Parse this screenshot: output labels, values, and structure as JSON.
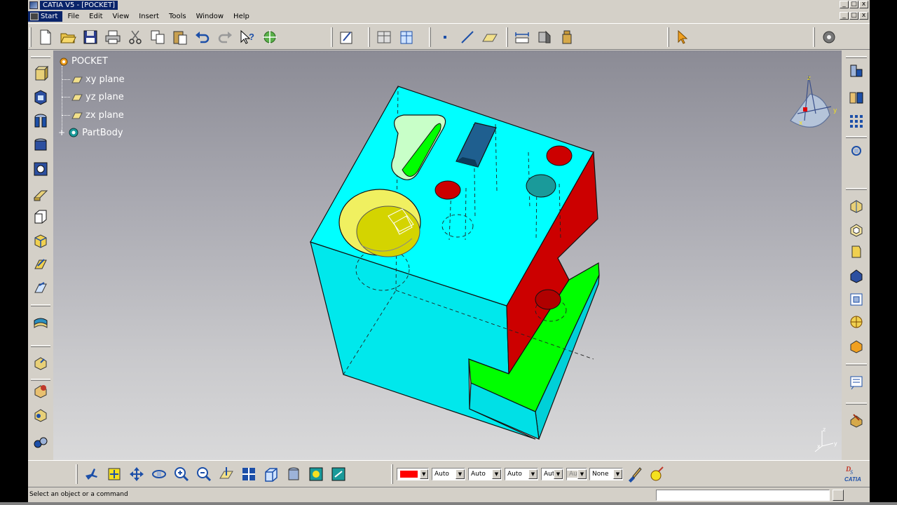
{
  "window": {
    "title": "CATIA V5 - [POCKET]",
    "controls": [
      "_",
      "□",
      "x"
    ]
  },
  "menu": {
    "items": [
      "Start",
      "File",
      "Edit",
      "View",
      "Insert",
      "Tools",
      "Window",
      "Help"
    ]
  },
  "tree": {
    "root": "POCKET",
    "children": [
      "xy plane",
      "yz plane",
      "zx plane",
      "PartBody"
    ]
  },
  "properties": {
    "fill_color": "#ff0000",
    "line_thickness": "Auto",
    "line_type": "Auto",
    "line_weight": "Auto",
    "layer_short": "Aut",
    "layer_disabled": "Aut",
    "render_style": "None"
  },
  "status": {
    "message": "Select an object or a command",
    "command_value": ""
  },
  "compass_axes": [
    "z",
    "y",
    "x"
  ],
  "axis_triad": [
    "z",
    "y",
    "x"
  ],
  "colors": {
    "model_face": "#00ffff",
    "model_side": "#00e8ec",
    "red_face": "#cc0000",
    "green_face": "#00ff00",
    "yellow_hole": "#e6e600",
    "title_bar": "#0a246a",
    "ui_face": "#d4d0c8"
  },
  "icons": {
    "top": [
      "new-icon",
      "open-icon",
      "save-icon",
      "print-icon",
      "cut-icon",
      "copy-icon",
      "paste-icon",
      "undo-icon",
      "redo-icon",
      "whats-this-icon",
      "analysis-icon",
      "sketcher-icon",
      "axis-system-icon",
      "table-icon",
      "point-icon",
      "line-icon",
      "plane-icon",
      "measure-between-icon",
      "measure-item-icon",
      "measure-inertia-icon",
      "select-arrow-icon",
      "settings-gear-icon"
    ],
    "bottom": [
      "fly-mode-icon",
      "fit-all-icon",
      "pan-icon",
      "rotate-icon",
      "zoom-in-icon",
      "zoom-out-icon",
      "normal-view-icon",
      "multi-view-icon",
      "iso-view-icon",
      "view-mode-icon",
      "hide-show-icon",
      "swap-space-icon",
      "paint-brush-icon",
      "apply-material-icon"
    ]
  }
}
